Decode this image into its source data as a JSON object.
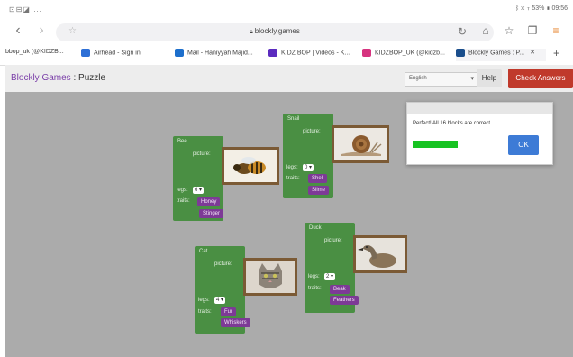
{
  "status": {
    "left_icons": "⊡⊟◪ ...",
    "right": "ᛒ ✕ ⊤ 53% ▮ 09:56"
  },
  "browser": {
    "url": "blockly.games",
    "tabs": [
      {
        "label": "bbop_uk (@KIDZB...",
        "color": "#cc2e77"
      },
      {
        "label": "Airhead - Sign in",
        "color": "#2d6fd6"
      },
      {
        "label": "Mail - Haniyyah Majid...",
        "color": "#1d6fcc"
      },
      {
        "label": "KIDZ BOP | Videos - K...",
        "color": "#5b2bbf"
      },
      {
        "label": "KIDZBOP_UK (@kidzb...",
        "color": "#d6337f"
      },
      {
        "label": "Blockly Games : P...",
        "color": "#1a4e8c"
      }
    ],
    "new_tab": "+",
    "tab_close": "✕"
  },
  "app": {
    "brand": "Blockly Games",
    "separator": " : ",
    "page": "Puzzle",
    "language": "English",
    "help": "Help",
    "check": "Check Answers"
  },
  "blocks": {
    "bee": {
      "name": "Bee",
      "picture": "picture:",
      "legs_label": "legs:",
      "legs": "6",
      "traits_label": "traits:",
      "traits": [
        "Honey",
        "Stinger"
      ]
    },
    "snail": {
      "name": "Snail",
      "picture": "picture:",
      "legs_label": "legs:",
      "legs": "0",
      "traits_label": "traits:",
      "traits": [
        "Shell",
        "Slime"
      ]
    },
    "cat": {
      "name": "Cat",
      "picture": "picture:",
      "legs_label": "legs:",
      "legs": "4",
      "traits_label": "traits:",
      "traits": [
        "Fur",
        "Whiskers"
      ]
    },
    "duck": {
      "name": "Duck",
      "picture": "picture:",
      "legs_label": "legs:",
      "legs": "2",
      "traits_label": "traits:",
      "traits": [
        "Beak",
        "Feathers"
      ]
    }
  },
  "dialog": {
    "message": "Perfect! All 16 blocks are correct.",
    "ok": "OK",
    "progress": 1.0
  },
  "colors": {
    "block": "#4a8f43",
    "trait": "#7d3a96",
    "check": "#c0392b",
    "ok": "#3d7bd6",
    "progress": "#17c322"
  }
}
